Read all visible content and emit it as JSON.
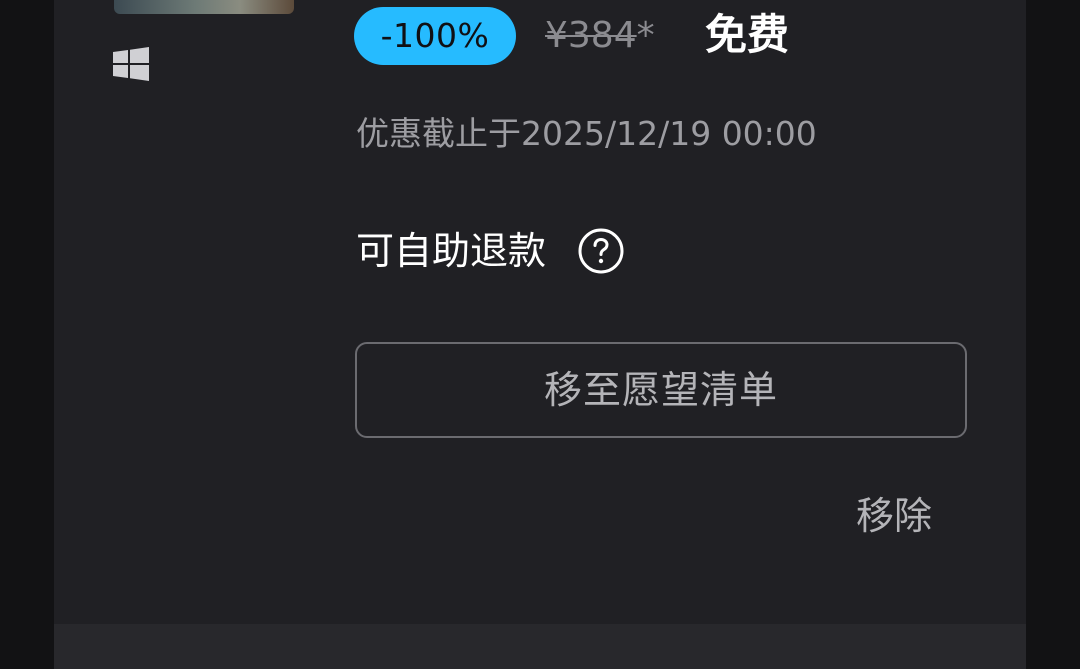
{
  "product": {
    "thumbnail_icon": "game-thumbnail",
    "platform_icon": "windows-icon",
    "discount_badge": "-100%",
    "original_price": "¥384",
    "original_price_suffix": "*",
    "final_price": "免费",
    "sale_end_text": "优惠截止于2025/12/19 00:00",
    "refund_label": "可自助退款",
    "refund_help_icon": "question-circle-icon"
  },
  "actions": {
    "move_to_wishlist_label": "移至愿望清单",
    "remove_label": "移除"
  },
  "colors": {
    "background": "#121214",
    "card": "#202024",
    "accent": "#26bbff",
    "text_primary": "#ffffff",
    "text_secondary": "#9d9da2"
  }
}
